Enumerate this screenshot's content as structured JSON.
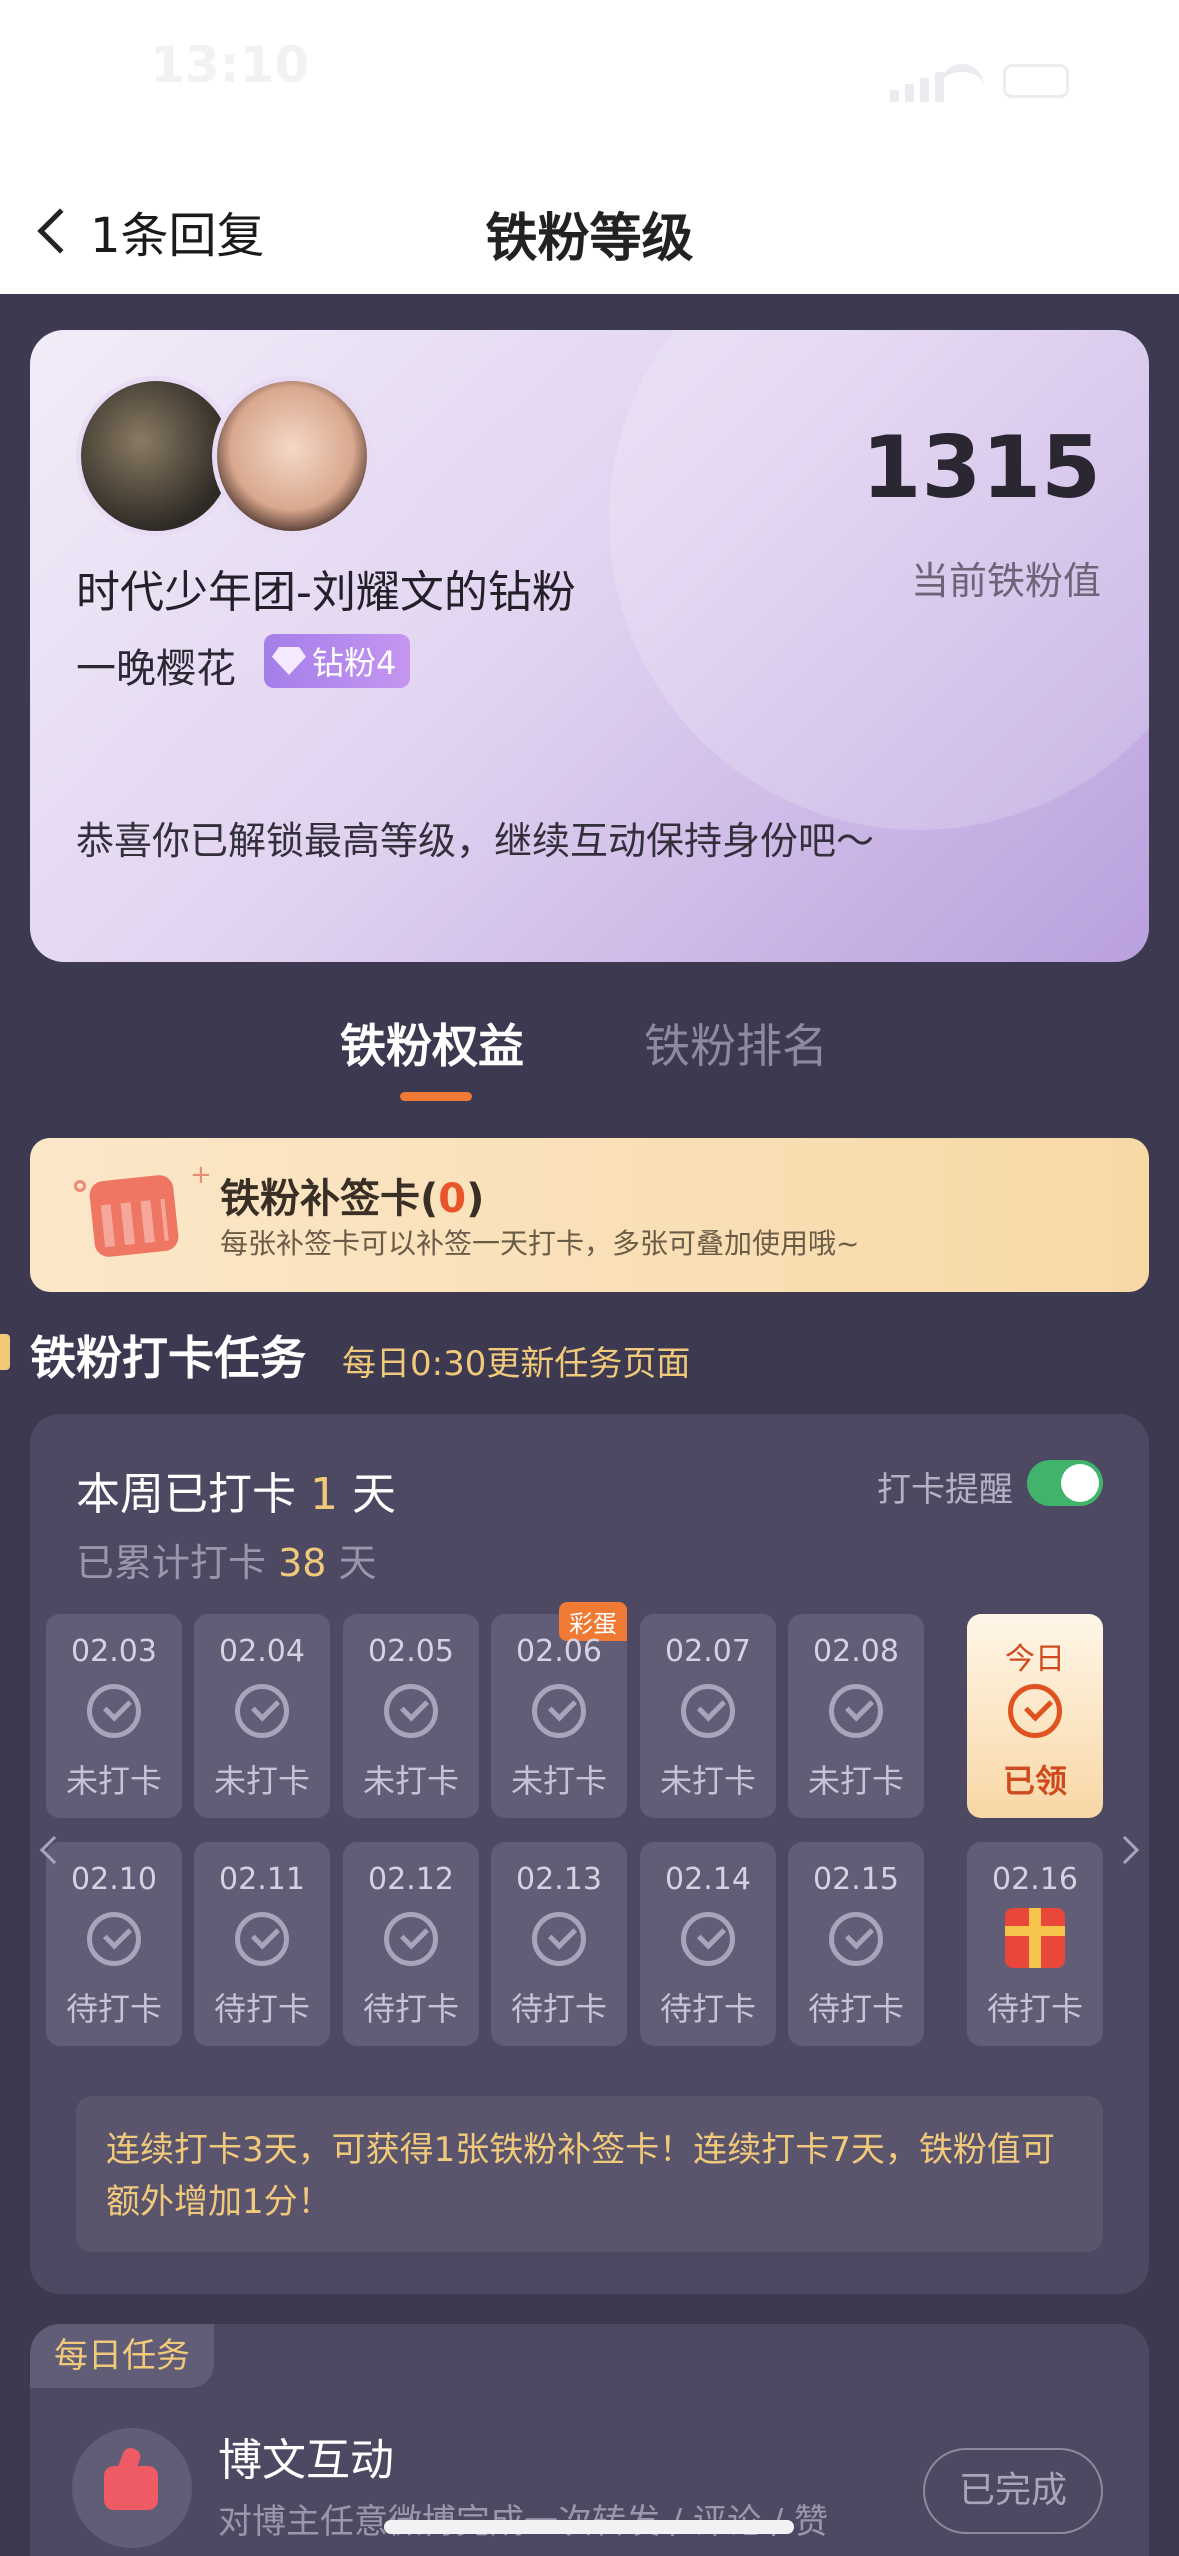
{
  "status_bar": {
    "time": "13:10"
  },
  "nav": {
    "back_label": "1条回复",
    "title": "铁粉等级"
  },
  "profile": {
    "fan_group": "时代少年团-刘耀文的钻粉",
    "nickname": "一晚樱花",
    "badge_label": "钻粉4",
    "score": "1315",
    "score_label": "当前铁粉值",
    "message": "恭喜你已解锁最高等级，继续互动保持身份吧～"
  },
  "tabs": [
    {
      "label": "铁粉权益",
      "active": true
    },
    {
      "label": "铁粉排名",
      "active": false
    }
  ],
  "makeup_card": {
    "title_prefix": "铁粉补签卡(",
    "count": "0",
    "title_suffix": ")",
    "desc": "每张补签卡可以补签一天打卡，多张可叠加使用哦~"
  },
  "checkin_section": {
    "title": "铁粉打卡任务",
    "subtitle": "每日0:30更新任务页面"
  },
  "checkin": {
    "week_prefix": "本周已打卡 ",
    "week_days": "1",
    "week_suffix": " 天",
    "total_prefix": "已累计打卡 ",
    "total_days": "38",
    "total_suffix": " 天",
    "reminder_label": "打卡提醒",
    "reminder_on": true,
    "egg_label": "彩蛋",
    "days_row1": [
      {
        "date": "02.03",
        "status": "未打卡"
      },
      {
        "date": "02.04",
        "status": "未打卡"
      },
      {
        "date": "02.05",
        "status": "未打卡"
      },
      {
        "date": "02.06",
        "status": "未打卡"
      },
      {
        "date": "02.07",
        "status": "未打卡"
      },
      {
        "date": "02.08",
        "status": "未打卡"
      },
      {
        "date": "今日",
        "status": "已领"
      }
    ],
    "days_row2": [
      {
        "date": "02.10",
        "status": "待打卡"
      },
      {
        "date": "02.11",
        "status": "待打卡"
      },
      {
        "date": "02.12",
        "status": "待打卡"
      },
      {
        "date": "02.13",
        "status": "待打卡"
      },
      {
        "date": "02.14",
        "status": "待打卡"
      },
      {
        "date": "02.15",
        "status": "待打卡"
      },
      {
        "date": "02.16",
        "status": "待打卡"
      }
    ],
    "tip": "连续打卡3天，可获得1张铁粉补签卡！连续打卡7天，铁粉值可额外增加1分！"
  },
  "daily_task": {
    "tag": "每日任务",
    "title": "博文互动",
    "desc": "对博主任意微博完成一次转发 / 评论 / 赞",
    "button": "已完成"
  },
  "colors": {
    "accent": "#f07a33",
    "gold": "#f1c97b",
    "toggle_on": "#41b36a",
    "bg": "#3c3950"
  }
}
